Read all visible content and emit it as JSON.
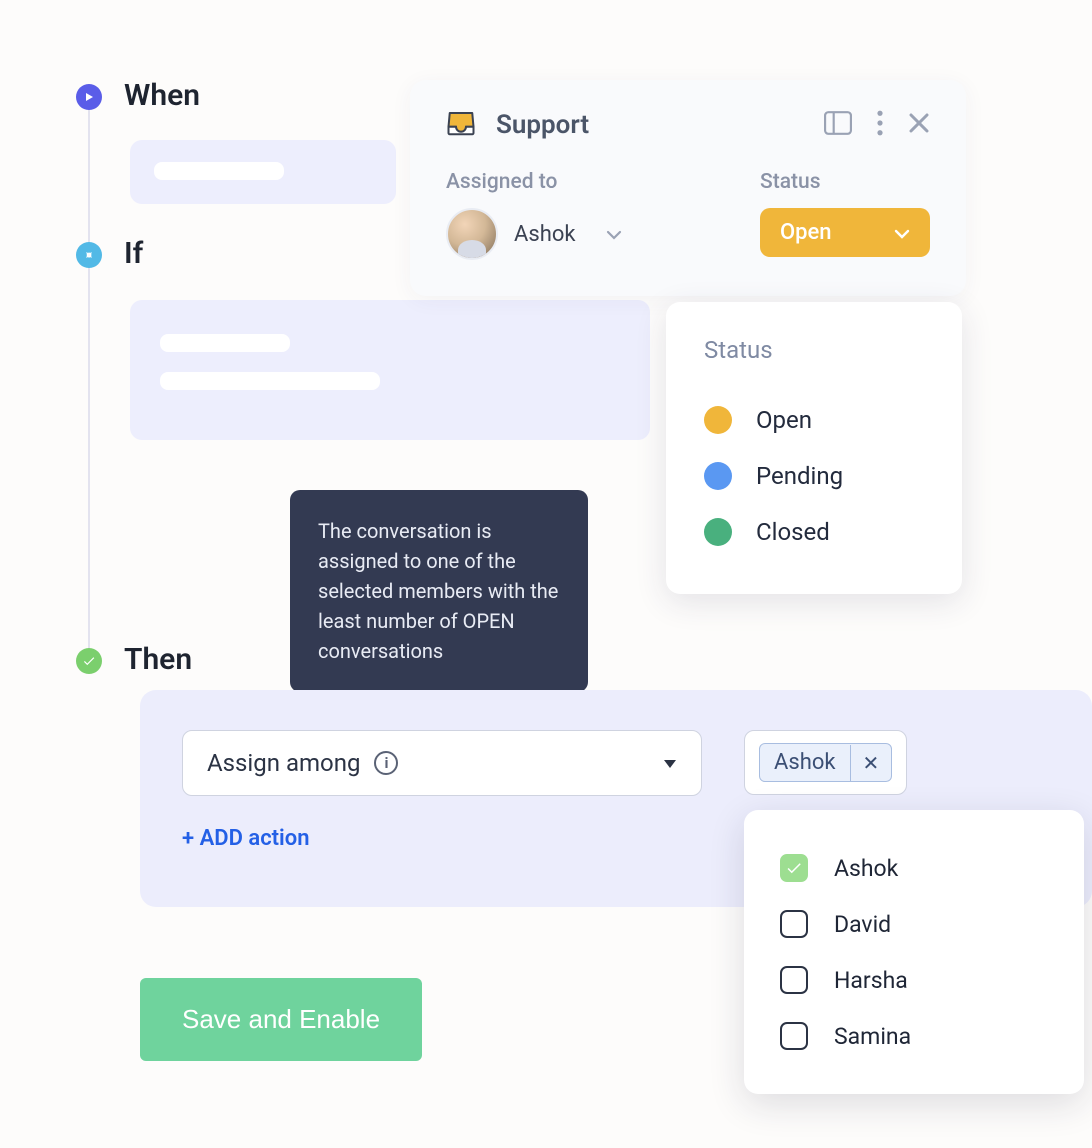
{
  "colors": {
    "nodeWhen": "#5a5de8",
    "nodeIf": "#52b9e6",
    "nodeThen": "#7bcf6d",
    "statusOpen": "#f0b63a",
    "statusPending": "#5a98f2",
    "statusClosed": "#49b07e"
  },
  "rule": {
    "when_label": "When",
    "if_label": "If",
    "then_label": "Then"
  },
  "support_panel": {
    "title": "Support",
    "assigned_label": "Assigned to",
    "status_label": "Status",
    "assignee_name": "Ashok",
    "status_value": "Open"
  },
  "status_dropdown": {
    "title": "Status",
    "options": [
      {
        "label": "Open"
      },
      {
        "label": "Pending"
      },
      {
        "label": "Closed"
      }
    ]
  },
  "tooltip_text": "The conversation is assigned to one of the selected members with the least number of OPEN conversations",
  "then_block": {
    "action_label": "Assign among",
    "add_action_label": "+ ADD action"
  },
  "member_chip": "Ashok",
  "member_dropdown": [
    {
      "name": "Ashok",
      "checked": true
    },
    {
      "name": "David",
      "checked": false
    },
    {
      "name": "Harsha",
      "checked": false
    },
    {
      "name": "Samina",
      "checked": false
    }
  ],
  "save_label": "Save and Enable"
}
